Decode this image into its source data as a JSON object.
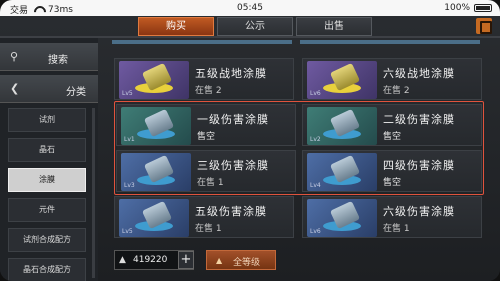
{
  "status_bar": {
    "carrier": "交易",
    "signal": "73ms",
    "time": "05:45",
    "battery": "100%"
  },
  "tabs": [
    {
      "label": "购买",
      "active": true
    },
    {
      "label": "公示",
      "active": false
    },
    {
      "label": "出售",
      "active": false
    }
  ],
  "sidebar": {
    "search_label": "搜索",
    "category_label": "分类",
    "items": [
      {
        "label": "试剂",
        "active": false
      },
      {
        "label": "晶石",
        "active": false
      },
      {
        "label": "涂膜",
        "active": true
      },
      {
        "label": "元件",
        "active": false
      },
      {
        "label": "试剂合成配方",
        "active": false
      },
      {
        "label": "晶石合成配方",
        "active": false
      }
    ]
  },
  "items": [
    {
      "title": "五级战地涂膜",
      "sub": "在售 2",
      "level": "Lv5",
      "color": "gold"
    },
    {
      "title": "六级战地涂膜",
      "sub": "在售 2",
      "level": "Lv6",
      "color": "gold"
    },
    {
      "title": "一级伤害涂膜",
      "sub": "售空",
      "level": "Lv1",
      "color": "teal"
    },
    {
      "title": "二级伤害涂膜",
      "sub": "售空",
      "level": "Lv2",
      "color": "teal"
    },
    {
      "title": "三级伤害涂膜",
      "sub": "在售 1",
      "level": "Lv3",
      "color": "blue"
    },
    {
      "title": "四级伤害涂膜",
      "sub": "售空",
      "level": "Lv4",
      "color": "blue"
    },
    {
      "title": "五级伤害涂膜",
      "sub": "在售 1",
      "level": "Lv5",
      "color": "blue"
    },
    {
      "title": "六级伤害涂膜",
      "sub": "在售 1",
      "level": "Lv6",
      "color": "blue"
    }
  ],
  "bottom": {
    "currency_value": "419220",
    "plus_label": "+",
    "level_filter_label": "全等级"
  }
}
